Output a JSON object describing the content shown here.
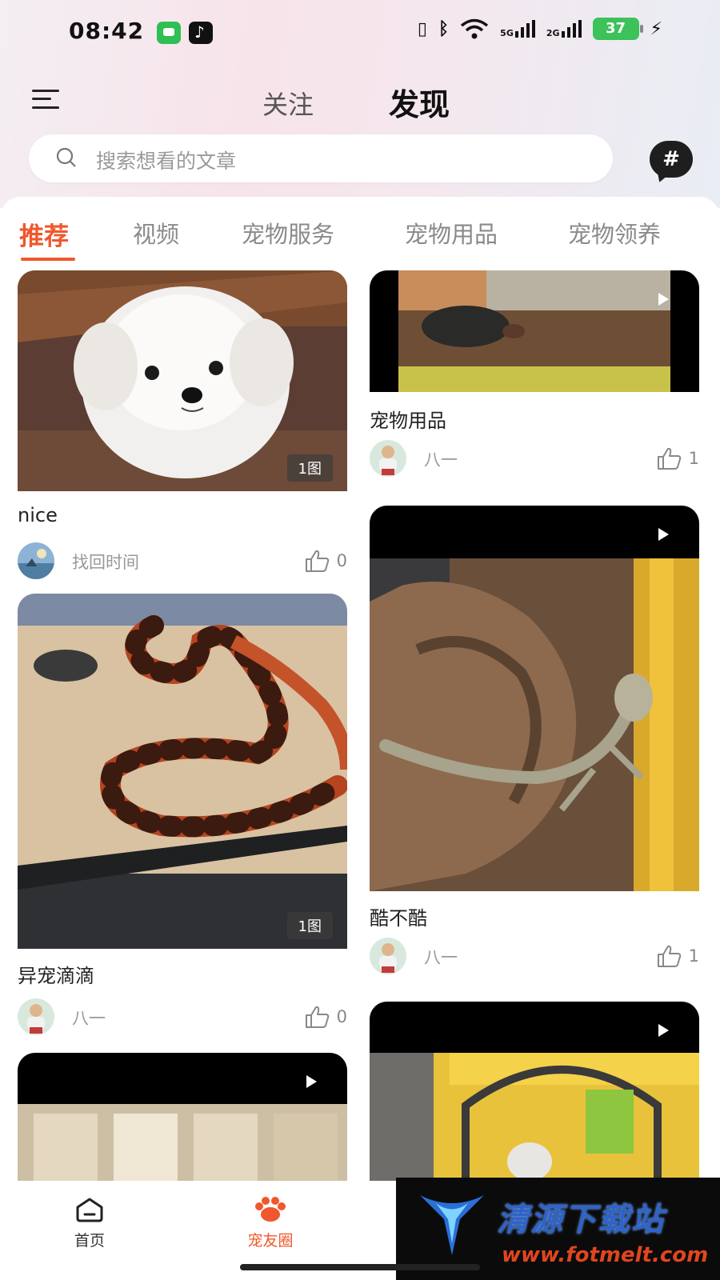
{
  "status_bar": {
    "time": "08:42",
    "signal_1_label": "5G",
    "signal_2_label": "2G",
    "battery": "37"
  },
  "header": {
    "tab_follow": "关注",
    "tab_discover": "发现"
  },
  "search": {
    "placeholder": "搜索想看的文章"
  },
  "hash_button": "#",
  "categories": [
    "推荐",
    "视频",
    "宠物服务",
    "宠物用品",
    "宠物领养"
  ],
  "active_category": "推荐",
  "feed": {
    "left": [
      {
        "title": "nice",
        "author": "找回时间",
        "likes": "0",
        "badge": "1图"
      },
      {
        "title": "异宠滴滴",
        "author": "八一",
        "likes": "0",
        "badge": "1图"
      },
      {
        "title": "",
        "author": "",
        "likes": "",
        "badge": ""
      }
    ],
    "right": [
      {
        "title": "宠物用品",
        "author": "八一",
        "likes": "1"
      },
      {
        "title": "酷不酷",
        "author": "八一",
        "likes": "1"
      },
      {
        "title": "",
        "author": "",
        "likes": ""
      }
    ]
  },
  "bottom_nav": {
    "home": "首页",
    "pet_circle": "宠友圈"
  },
  "watermark": {
    "title": "清源下载站",
    "url": "www.fotmelt.com"
  },
  "colors": {
    "accent": "#f0572c",
    "text_muted": "#999999"
  }
}
